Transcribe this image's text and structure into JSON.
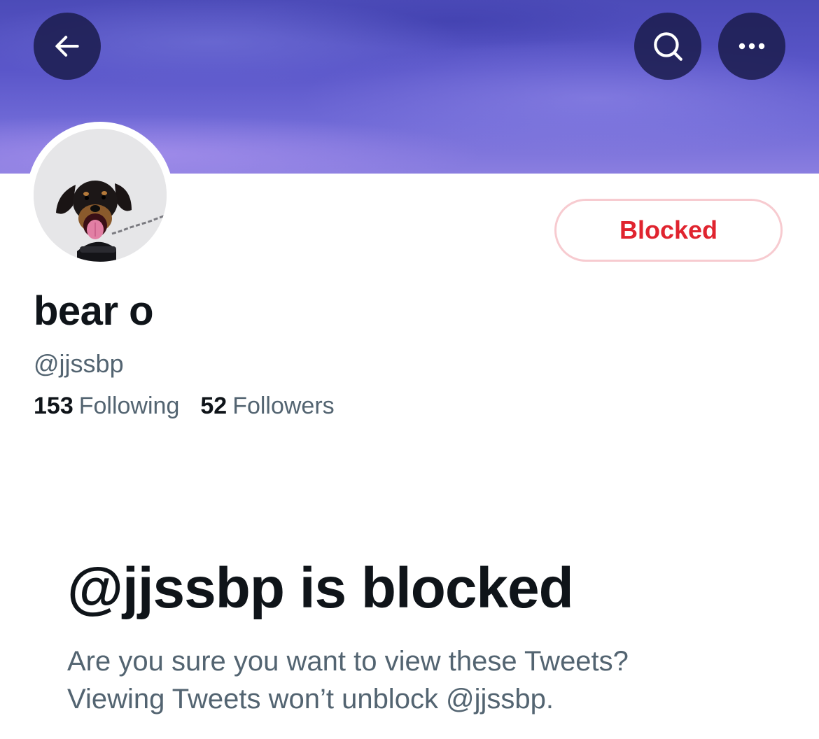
{
  "header": {
    "back_icon": "arrow-left-icon",
    "search_icon": "search-icon",
    "more_icon": "more-horizontal-icon"
  },
  "profile": {
    "avatar_icon": "dog-avatar",
    "display_name": "bear o",
    "handle": "@jjssbp",
    "blocked_button_label": "Blocked",
    "following_count": "153",
    "following_label": "Following",
    "followers_count": "52",
    "followers_label": "Followers"
  },
  "blocked_notice": {
    "title": "@jjssbp is blocked",
    "line1": "Are you sure you want to view these Tweets?",
    "line2": "Viewing Tweets won’t unblock @jjssbp."
  },
  "colors": {
    "blocked_red": "#e0242f",
    "blocked_border": "#f7cbd0",
    "primary_text": "#0f1419",
    "secondary_text": "#536471",
    "banner_purple": "#5a56c9"
  }
}
